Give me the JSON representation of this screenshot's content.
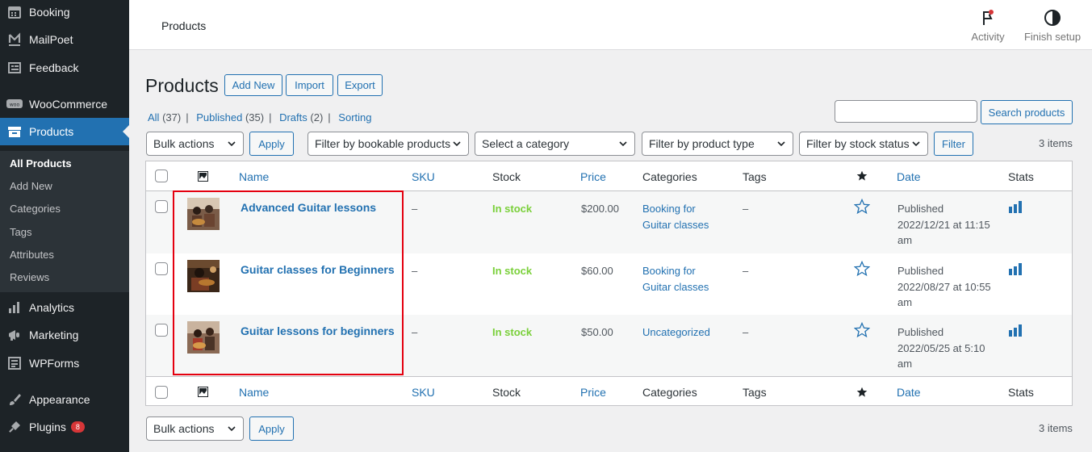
{
  "sidebar": {
    "items": [
      {
        "label": "Booking",
        "icon": "calendar-icon"
      },
      {
        "label": "MailPoet",
        "icon": "mailpoet-icon"
      },
      {
        "label": "Feedback",
        "icon": "feedback-icon"
      },
      {
        "label": "WooCommerce",
        "icon": "woocommerce-icon"
      },
      {
        "label": "Products",
        "icon": "archive-icon"
      },
      {
        "label": "Analytics",
        "icon": "chart-icon"
      },
      {
        "label": "Marketing",
        "icon": "megaphone-icon"
      },
      {
        "label": "WPForms",
        "icon": "form-icon"
      },
      {
        "label": "Appearance",
        "icon": "paintbrush-icon"
      },
      {
        "label": "Plugins",
        "icon": "plugin-icon",
        "badge": "8"
      }
    ],
    "submenu": [
      "All Products",
      "Add New",
      "Categories",
      "Tags",
      "Attributes",
      "Reviews"
    ]
  },
  "topbar": {
    "title": "Products",
    "activity": "Activity",
    "finish_setup": "Finish setup"
  },
  "page": {
    "title": "Products",
    "add_new": "Add New",
    "import": "Import",
    "export": "Export"
  },
  "views": {
    "all": "All",
    "all_count": "(37)",
    "published": "Published",
    "published_count": "(35)",
    "drafts": "Drafts",
    "drafts_count": "(2)",
    "sorting": "Sorting"
  },
  "search": {
    "button": "Search products"
  },
  "filters": {
    "bulk_actions": "Bulk actions",
    "apply": "Apply",
    "bookable": "Filter by bookable products",
    "category": "Select a category",
    "product_type": "Filter by product type",
    "stock_status": "Filter by stock status",
    "filter": "Filter",
    "items": "3 items"
  },
  "columns": {
    "name": "Name",
    "sku": "SKU",
    "stock": "Stock",
    "price": "Price",
    "categories": "Categories",
    "tags": "Tags",
    "date": "Date",
    "stats": "Stats"
  },
  "products": [
    {
      "name": "Advanced Guitar lessons",
      "sku": "–",
      "stock": "In stock",
      "price": "$200.00",
      "category_line1": "Booking for",
      "category_line2": "Guitar classes",
      "tags": "–",
      "date_status": "Published",
      "date_line1": "2022/12/21 at 11:15",
      "date_line2": "am"
    },
    {
      "name": "Guitar classes for Beginners",
      "sku": "–",
      "stock": "In stock",
      "price": "$60.00",
      "category_line1": "Booking for",
      "category_line2": "Guitar classes",
      "tags": "–",
      "date_status": "Published",
      "date_line1": "2022/08/27 at 10:55",
      "date_line2": "am"
    },
    {
      "name": "Guitar lessons for beginners",
      "sku": "–",
      "stock": "In stock",
      "price": "$50.00",
      "category_line1": "Uncategorized",
      "category_line2": "",
      "tags": "–",
      "date_status": "Published",
      "date_line1": "2022/05/25 at 5:10",
      "date_line2": "am"
    }
  ],
  "colors": {
    "accent": "#2271b1",
    "sidebar": "#1d2327",
    "instock": "#7ad03a",
    "highlight": "#e4000f"
  }
}
